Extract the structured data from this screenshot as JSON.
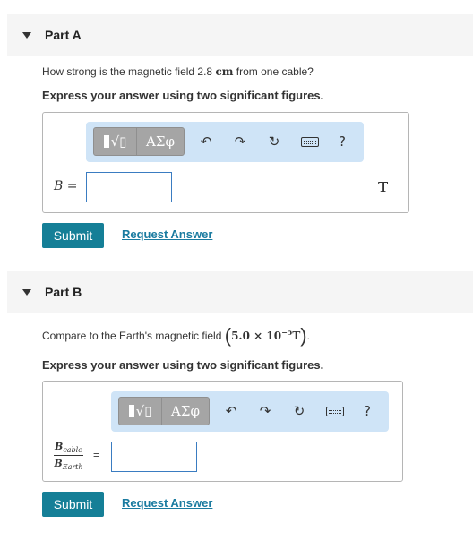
{
  "part_a": {
    "header": "Part A",
    "question_pre": "How strong is the magnetic field 2.8 ",
    "question_unit": "cm",
    "question_post": " from one cable?",
    "instruction": "Express your answer using two significant figures.",
    "toolbar": {
      "templates_glyph": "√▯",
      "greek_label": "ΑΣφ",
      "undo_glyph": "↶",
      "redo_glyph": "↷",
      "reset_glyph": "↻",
      "help_glyph": "?"
    },
    "variable_label": "B =",
    "input_value": "",
    "unit": "T",
    "submit_label": "Submit",
    "request_label": "Request Answer"
  },
  "part_b": {
    "header": "Part B",
    "question_pre": "Compare to the Earth's magnetic field ",
    "field_value": "5.0 × 10",
    "field_exp": "−5",
    "field_unit": "T",
    "question_post": ".",
    "instruction": "Express your answer using two significant figures.",
    "toolbar": {
      "templates_glyph": "√▯",
      "greek_label": "ΑΣφ",
      "undo_glyph": "↶",
      "redo_glyph": "↷",
      "reset_glyph": "↻",
      "help_glyph": "?"
    },
    "fraction_num": "B",
    "fraction_num_sub": "cable",
    "fraction_den": "B",
    "fraction_den_sub": "Earth",
    "equals": "=",
    "input_value": "",
    "submit_label": "Submit",
    "request_label": "Request Answer"
  },
  "colors": {
    "submit_bg": "#157f97",
    "link": "#1a7ba0",
    "toolbar_bg": "#cfe4f7",
    "input_border": "#3a7cc1"
  }
}
